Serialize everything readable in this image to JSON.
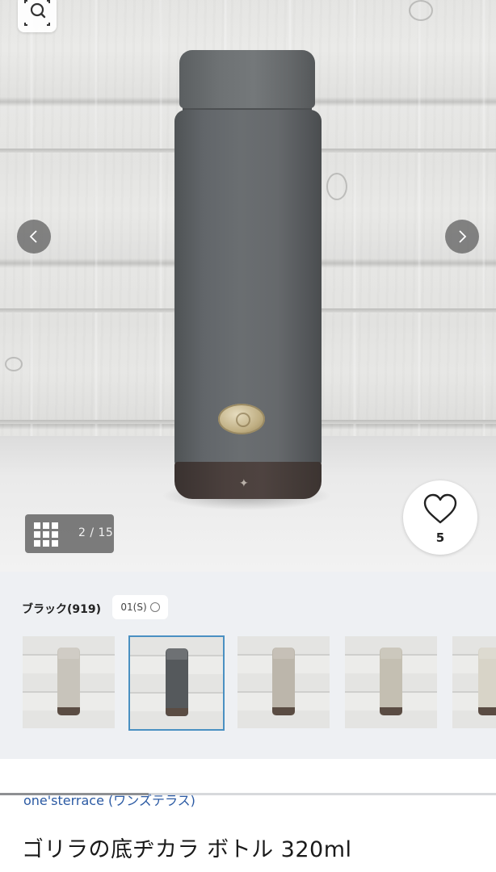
{
  "gallery": {
    "counter": "2 / 15",
    "zoom_icon": "zoom-search-icon",
    "prev_icon": "chevron-left-icon",
    "next_icon": "chevron-right-icon",
    "grid_icon": "grid-icon"
  },
  "favorite": {
    "icon": "heart-outline-icon",
    "count": "5"
  },
  "variant": {
    "color_label": "ブラック(919)",
    "size_option": "01(S)",
    "thumbnails": [
      {
        "color": "#c8c4bb",
        "selected": false
      },
      {
        "color": "#55595c",
        "selected": true
      },
      {
        "color": "#bcb6ab",
        "selected": false
      },
      {
        "color": "#c4bfb2",
        "selected": false
      },
      {
        "color": "#d8d4c8",
        "selected": false
      }
    ],
    "scroll_progress": 0.3
  },
  "product": {
    "brand": "one'sterrace (ワンズテラス)",
    "title": "ゴリラの底ヂカラ ボトル 320ml"
  },
  "colors": {
    "brand_link": "#2b5aa3",
    "selected_border": "#4a90c2",
    "band_bg": "#eef0f3"
  }
}
